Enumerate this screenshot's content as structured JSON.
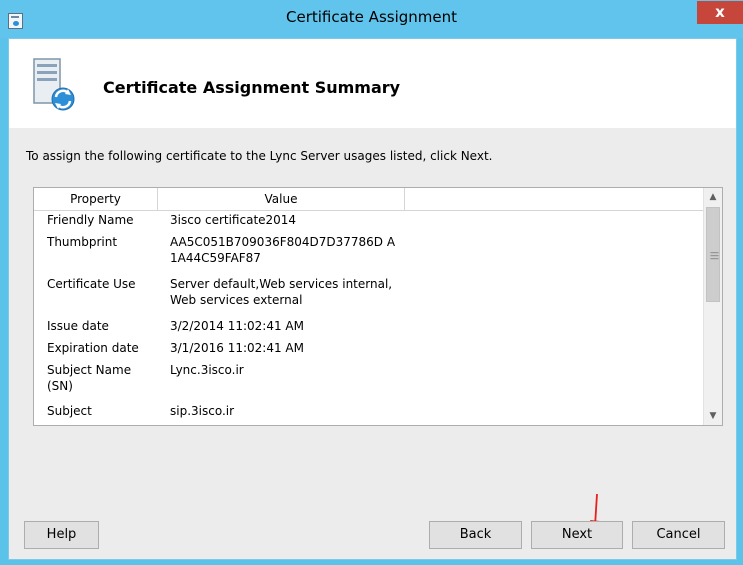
{
  "window": {
    "title": "Certificate Assignment",
    "close_glyph": "x"
  },
  "header": {
    "title": "Certificate Assignment Summary",
    "icon": "server-sync-icon"
  },
  "instruction": "To assign the following certificate to the Lync Server usages listed, click Next.",
  "table": {
    "columns": [
      "Property",
      "Value",
      ""
    ],
    "rows": [
      {
        "property": "Friendly Name",
        "value": "3isco certificate2014"
      },
      {
        "property": "Thumbprint",
        "value": "AA5C051B709036F804D7D37786D A1A44C59FAF87"
      },
      {
        "property": "Certificate Use",
        "value": "Server default,Web services internal,Web services external"
      },
      {
        "property": "Issue date",
        "value": "3/2/2014 11:02:41 AM"
      },
      {
        "property": "Expiration date",
        "value": "3/1/2016 11:02:41 AM"
      },
      {
        "property": "Subject Name (SN)",
        "value": "Lync.3isco.ir"
      },
      {
        "property": "Subject",
        "value": "sip.3isco.ir"
      }
    ]
  },
  "buttons": {
    "help": "Help",
    "back": "Back",
    "next": "Next",
    "cancel": "Cancel"
  },
  "colors": {
    "titlebar": "#60c4ec",
    "close_button": "#c7463c",
    "annotation_arrow": "#e8211b"
  }
}
